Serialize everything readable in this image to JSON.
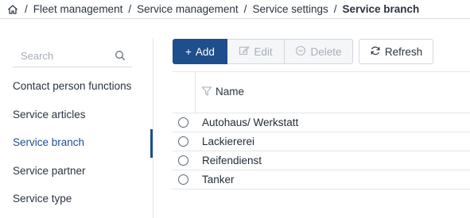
{
  "breadcrumb": {
    "items": [
      "Fleet management",
      "Service management",
      "Service settings"
    ],
    "current": "Service branch",
    "separator": "/"
  },
  "sidebar": {
    "search_placeholder": "Search",
    "items": [
      {
        "label": "Contact person functions"
      },
      {
        "label": "Service articles"
      },
      {
        "label": "Service branch",
        "active": true
      },
      {
        "label": "Service partner"
      },
      {
        "label": "Service type"
      }
    ]
  },
  "toolbar": {
    "add_label": "Add",
    "edit_label": "Edit",
    "delete_label": "Delete",
    "refresh_label": "Refresh"
  },
  "grid": {
    "column_name": "Name",
    "rows": [
      {
        "name": "Autohaus/ Werkstatt"
      },
      {
        "name": "Lackiererei"
      },
      {
        "name": "Reifendienst"
      },
      {
        "name": "Tanker"
      }
    ]
  },
  "colors": {
    "primary": "#1f4e8c",
    "border": "#e3e6ea"
  }
}
